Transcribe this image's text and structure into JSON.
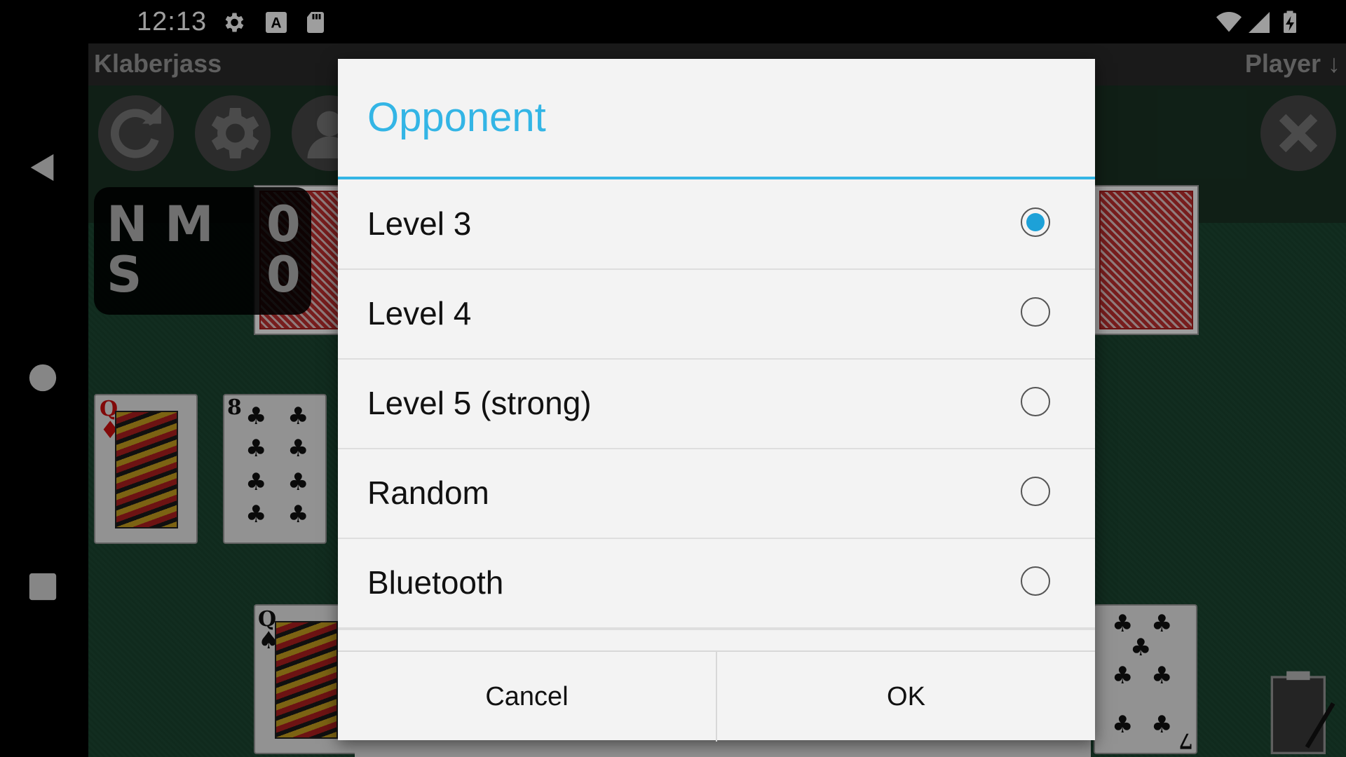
{
  "status_bar": {
    "time": "12:13",
    "left_icons": [
      "gear-icon",
      "keyboard-a-icon",
      "sd-card-icon"
    ],
    "right_icons": [
      "wifi-icon",
      "cell-signal-icon",
      "battery-charging-icon"
    ]
  },
  "app": {
    "title": "Klaberjass",
    "player_label": "Player ↓",
    "toolbar_icons": [
      "refresh-icon",
      "settings-icon",
      "person-icon",
      "close-x-icon"
    ]
  },
  "scoreboard": {
    "row1_letters": "N M",
    "row2_letters": "S",
    "score1": "0",
    "score2": "0"
  },
  "cards": {
    "queen_diamonds": {
      "rank": "Q",
      "suit": "♦"
    },
    "eight_clubs": {
      "rank": "8",
      "suit": "♣"
    },
    "queen_spades": {
      "rank": "Q",
      "suit": "♠"
    },
    "seven_clubs": {
      "rank": "7",
      "suit": "♣"
    }
  },
  "dialog": {
    "title": "Opponent",
    "options": [
      {
        "label": "Level 3",
        "selected": true
      },
      {
        "label": "Level 4",
        "selected": false
      },
      {
        "label": "Level 5 (strong)",
        "selected": false
      },
      {
        "label": "Random",
        "selected": false
      },
      {
        "label": "Bluetooth",
        "selected": false
      }
    ],
    "cancel_label": "Cancel",
    "ok_label": "OK"
  },
  "colors": {
    "accent": "#33b5e5",
    "radio_selected": "#1da1d8",
    "felt": "#1e4a34"
  }
}
